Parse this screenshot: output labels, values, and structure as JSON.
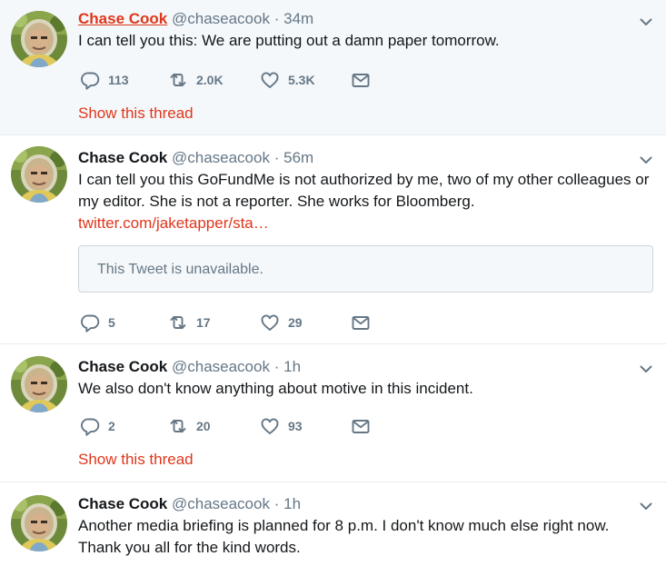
{
  "tweets": [
    {
      "name": "Chase Cook",
      "handle": "@chaseacook",
      "separator": "·",
      "time": "34m",
      "text": "I can tell you this: We are putting out a damn paper tomorrow.",
      "replies": "113",
      "retweets": "2.0K",
      "likes": "5.3K",
      "show_thread": "Show this thread"
    },
    {
      "name": "Chase Cook",
      "handle": "@chaseacook",
      "separator": "·",
      "time": "56m",
      "text": "I can tell you this GoFundMe is not authorized by me, two of my other colleagues or my editor. She is not a reporter. She works for Bloomberg.",
      "link": "twitter.com/jaketapper/sta…",
      "quote": "This Tweet is unavailable.",
      "replies": "5",
      "retweets": "17",
      "likes": "29"
    },
    {
      "name": "Chase Cook",
      "handle": "@chaseacook",
      "separator": "·",
      "time": "1h",
      "text": "We also don't know anything about motive in this incident.",
      "replies": "2",
      "retweets": "20",
      "likes": "93",
      "show_thread": "Show this thread"
    },
    {
      "name": "Chase Cook",
      "handle": "@chaseacook",
      "separator": "·",
      "time": "1h",
      "text": "Another media briefing is planned for 8 p.m. I don't know much else right now. Thank you all for the kind words."
    }
  ],
  "icons": {
    "reply": "reply-icon",
    "retweet": "retweet-icon",
    "like": "heart-icon",
    "dm": "envelope-icon",
    "caret": "chevron-down-icon"
  },
  "colors": {
    "accent": "#e0361c",
    "muted": "#657786",
    "text": "#14171a",
    "highlight_bg": "#f5f8fa",
    "divider": "#e6ecf0"
  }
}
